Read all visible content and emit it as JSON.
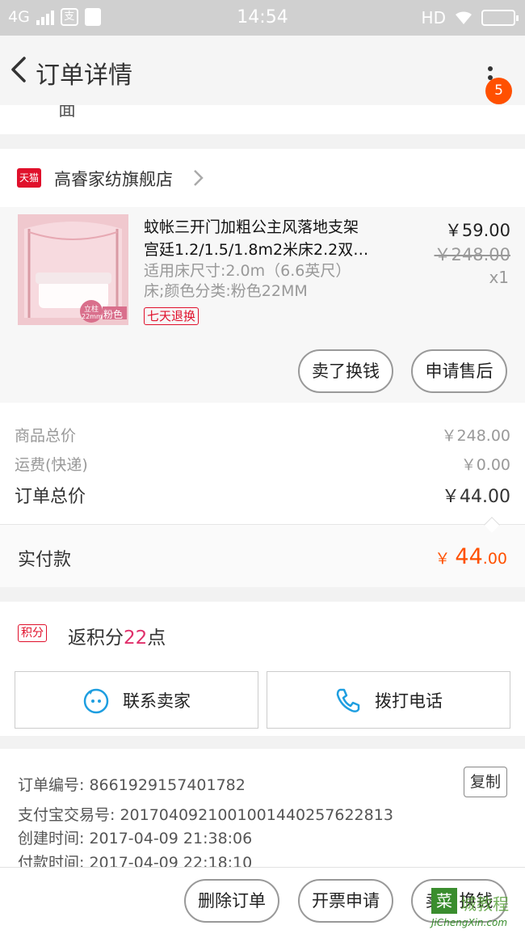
{
  "status_bar": {
    "network": "4G",
    "app_icon_glyph": "支",
    "time": "14:54",
    "hd": "HD"
  },
  "nav": {
    "title": "订单详情",
    "badge_count": "5"
  },
  "partial_text": "面",
  "store": {
    "icon_label": "天猫",
    "name": "高睿家纺旗舰店"
  },
  "product": {
    "title_line1": "蚊帐三开门加粗公主风落地支架",
    "title_line2": "宫廷1.2/1.5/1.8m2米床2.2双…",
    "sku_line1": "适用床尺寸:2.0m（6.6英尺）",
    "sku_line2": "床;颜色分类:粉色22MM",
    "return_tag": "七天退换",
    "price": "￥59.00",
    "original_price": "￥248.00",
    "quantity": "x1",
    "image_badge_top": "立柱",
    "image_badge_bottom": "22mm",
    "image_color_label": "粉色"
  },
  "product_actions": {
    "sell_label": "卖了换钱",
    "aftersale_label": "申请售后"
  },
  "totals": {
    "goods_label": "商品总价",
    "goods_value": "￥248.00",
    "shipping_label": "运费(快递)",
    "shipping_value": "￥0.00",
    "order_label": "订单总价",
    "order_value": "￥44.00"
  },
  "paid": {
    "label": "实付款",
    "currency": "￥",
    "integer": "44",
    "decimal": ".00"
  },
  "points": {
    "tag": "积分",
    "prefix": "返积分",
    "value": "22",
    "suffix": "点"
  },
  "contact": {
    "seller_label": "联系卖家",
    "phone_label": "拨打电话"
  },
  "order_info": {
    "order_no": "订单编号: 8661929157401782",
    "copy_label": "复制",
    "alipay_no": "支付宝交易号: 2017040921001001440257622813",
    "created": "创建时间: 2017-04-09 21:38:06",
    "paid_time": "付款时间: 2017-04-09 22:18:10"
  },
  "bottom_bar": {
    "delete_label": "删除订单",
    "invoice_label": "开票申请",
    "sell_label": "卖了换钱"
  },
  "watermark": {
    "box": "菜",
    "text": "城教程",
    "sub": "JiChengXin.com"
  },
  "colors": {
    "accent": "#ff5000",
    "tmall_red": "#e0102b",
    "points_pink": "#e0306b"
  }
}
